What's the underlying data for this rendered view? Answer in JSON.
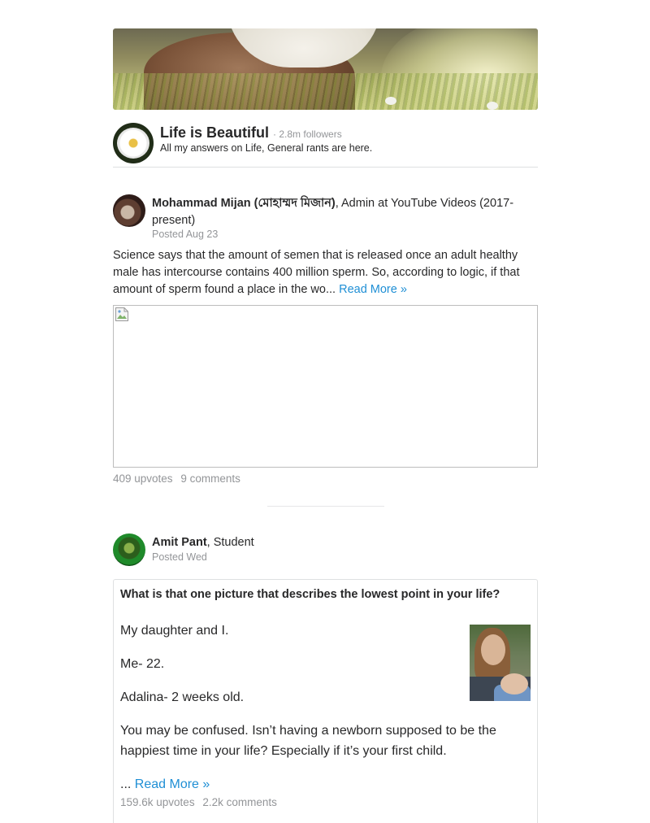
{
  "space": {
    "name": "Life is Beautiful",
    "followers": "· 2.8m followers",
    "description": "All my answers on Life, General rants are here."
  },
  "post1": {
    "author_name": "Mohammad Mijan (মোহাম্মদ মিজান)",
    "author_credential": ", Admin at YouTube Videos (2017-present)",
    "posted": "Posted Aug 23",
    "body": "Science says that the amount of semen that is released once an adult healthy male has intercourse contains 400 million sperm. So, according to logic, if that amount of sperm found a place in the wo...",
    "read_more": "Read More »",
    "upvotes": "409 upvotes",
    "comments": "9 comments"
  },
  "post2": {
    "author_name": "Amit Pant",
    "author_credential": ", Student",
    "posted": "Posted Wed",
    "question": "What is that one picture that describes the lowest point in your life?",
    "paragraphs": [
      "My daughter and I.",
      "Me- 22.",
      "Adalina- 2 weeks old.",
      "You may be confused. Isn’t having a newborn supposed to be the happiest time in your life? Especially if it’s your first child."
    ],
    "ellipsis": "...",
    "read_more": "Read More »",
    "upvotes": "159.6k upvotes",
    "comments": "2.2k comments"
  },
  "colors": {
    "link": "#1f8fd5",
    "muted": "#939598",
    "text": "#282829"
  }
}
